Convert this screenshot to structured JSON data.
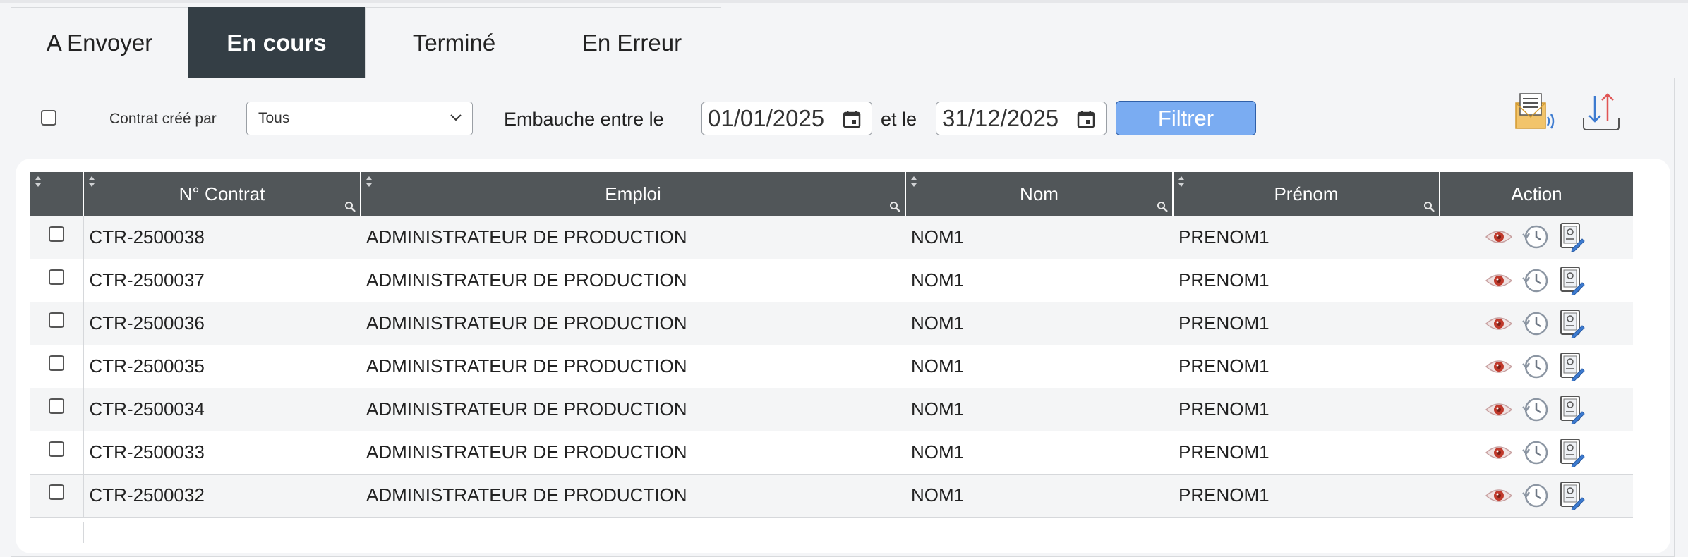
{
  "tabs": [
    {
      "label": "A Envoyer",
      "active": false
    },
    {
      "label": "En cours",
      "active": true
    },
    {
      "label": "Terminé",
      "active": false
    },
    {
      "label": "En Erreur",
      "active": false
    }
  ],
  "filters": {
    "created_by_label": "Contrat créé par",
    "created_by_value": "Tous",
    "hire_between_label": "Embauche entre le",
    "date_from": "01/01/2025",
    "and_label": "et le",
    "date_to": "31/12/2025",
    "filter_button": "Filtrer"
  },
  "toolbar_icons": [
    "mail-signal-icon",
    "upload-download-icon"
  ],
  "table": {
    "columns": [
      "N° Contrat",
      "Emploi",
      "Nom",
      "Prénom",
      "Action"
    ],
    "rows": [
      {
        "contract": "CTR-2500038",
        "job": "ADMINISTRATEUR DE PRODUCTION",
        "last": "NOM1",
        "first": "PRENOM1"
      },
      {
        "contract": "CTR-2500037",
        "job": "ADMINISTRATEUR DE PRODUCTION",
        "last": "NOM1",
        "first": "PRENOM1"
      },
      {
        "contract": "CTR-2500036",
        "job": "ADMINISTRATEUR DE PRODUCTION",
        "last": "NOM1",
        "first": "PRENOM1"
      },
      {
        "contract": "CTR-2500035",
        "job": "ADMINISTRATEUR DE PRODUCTION",
        "last": "NOM1",
        "first": "PRENOM1"
      },
      {
        "contract": "CTR-2500034",
        "job": "ADMINISTRATEUR DE PRODUCTION",
        "last": "NOM1",
        "first": "PRENOM1"
      },
      {
        "contract": "CTR-2500033",
        "job": "ADMINISTRATEUR DE PRODUCTION",
        "last": "NOM1",
        "first": "PRENOM1"
      },
      {
        "contract": "CTR-2500032",
        "job": "ADMINISTRATEUR DE PRODUCTION",
        "last": "NOM1",
        "first": "PRENOM1"
      }
    ],
    "row_actions": [
      "eye-icon",
      "history-icon",
      "edit-document-icon"
    ]
  },
  "colors": {
    "active_tab": "#343e45",
    "header_bg": "#515659",
    "filter_button": "#7aacf2",
    "eye_red": "#c0392b"
  }
}
